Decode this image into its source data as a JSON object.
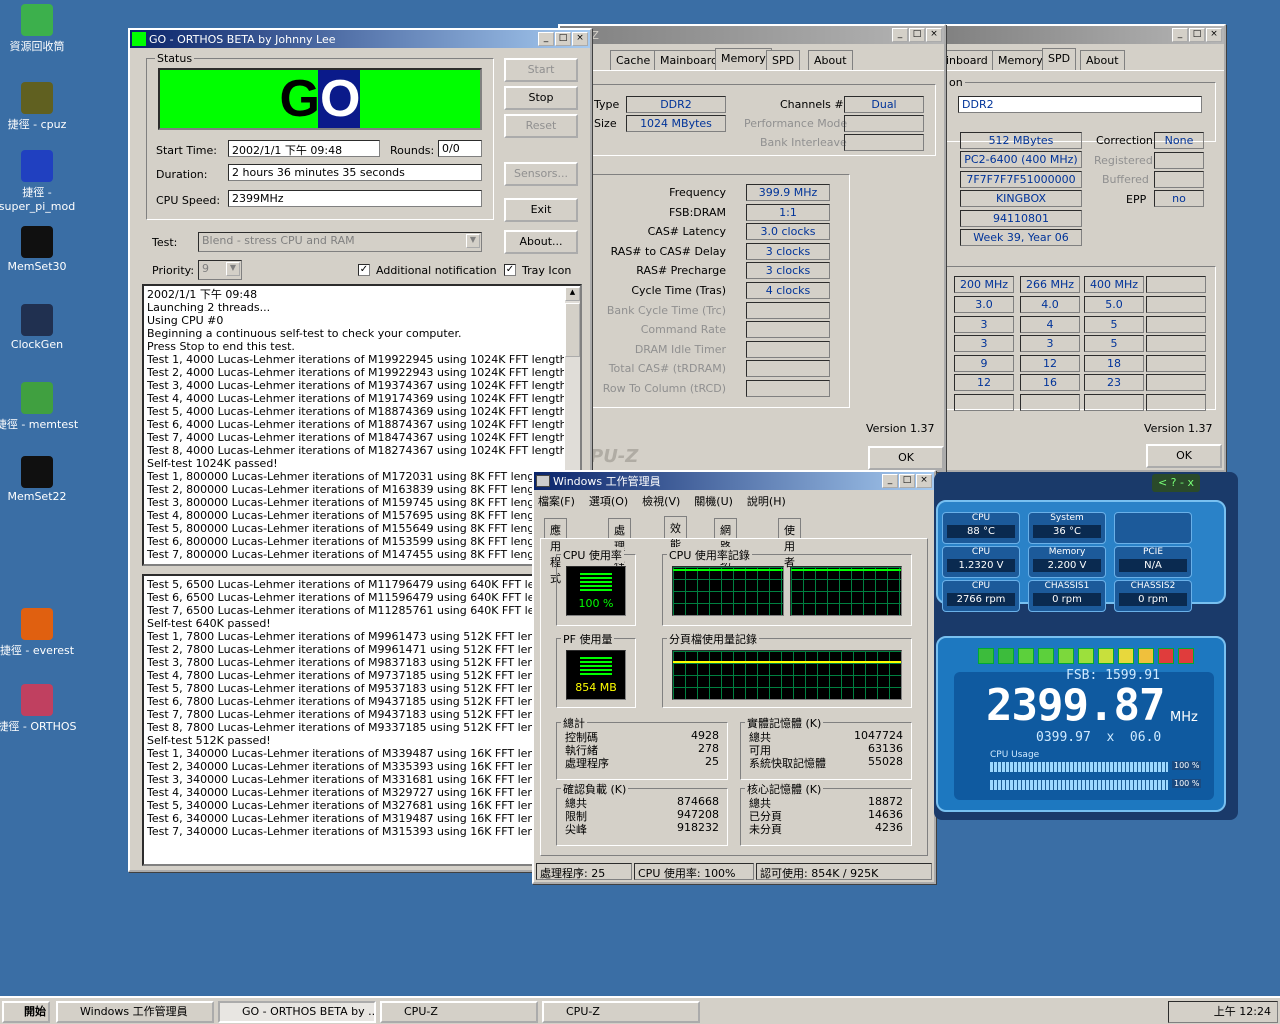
{
  "desktop": {
    "icons": [
      {
        "label": "資源回收筒",
        "color": "#3cb04c"
      },
      {
        "label": "捷徑 - cpuz",
        "color": "#606020"
      },
      {
        "label": "捷徑 - super_pi_mod",
        "color": "#2040c0"
      },
      {
        "label": "MemSet30",
        "color": "#101010"
      },
      {
        "label": "ClockGen",
        "color": "#203050"
      },
      {
        "label": "捷徑 - memtest",
        "color": "#40a040"
      },
      {
        "label": "MemSet22",
        "color": "#101010"
      },
      {
        "label": "捷徑 - everest",
        "color": "#e06010"
      },
      {
        "label": "捷徑 - ORTHOS",
        "color": "#c04060"
      }
    ]
  },
  "orthos": {
    "title": "GO - ORTHOS BETA by Johnny Lee",
    "status_label": "Status",
    "go_text": "GO",
    "start_time_label": "Start Time:",
    "start_time": "2002/1/1 下午 09:48",
    "rounds_label": "Rounds:",
    "rounds": "0/0",
    "duration_label": "Duration:",
    "duration": "2 hours 36 minutes 35 seconds",
    "cpu_speed_label": "CPU Speed:",
    "cpu_speed": "2399MHz",
    "btn_start": "Start",
    "btn_stop": "Stop",
    "btn_reset": "Reset",
    "btn_sensors": "Sensors...",
    "btn_exit": "Exit",
    "btn_about": "About...",
    "test_label": "Test:",
    "test_value": "Blend - stress CPU and RAM",
    "priority_label": "Priority:",
    "priority_value": "9",
    "additional_notification": "Additional notification",
    "tray_icon": "Tray Icon",
    "log1": [
      "2002/1/1 下午 09:48",
      "Launching 2 threads...",
      "Using CPU #0",
      "Beginning a continuous self-test to check your computer.",
      "Press Stop to end this test.",
      "Test 1, 4000 Lucas-Lehmer iterations of M19922945 using 1024K FFT length.",
      "Test 2, 4000 Lucas-Lehmer iterations of M19922943 using 1024K FFT length.",
      "Test 3, 4000 Lucas-Lehmer iterations of M19374367 using 1024K FFT length.",
      "Test 4, 4000 Lucas-Lehmer iterations of M19174369 using 1024K FFT length.",
      "Test 5, 4000 Lucas-Lehmer iterations of M18874369 using 1024K FFT length.",
      "Test 6, 4000 Lucas-Lehmer iterations of M18874367 using 1024K FFT length.",
      "Test 7, 4000 Lucas-Lehmer iterations of M18474367 using 1024K FFT length.",
      "Test 8, 4000 Lucas-Lehmer iterations of M18274367 using 1024K FFT length.",
      "Self-test 1024K passed!",
      "Test 1, 800000 Lucas-Lehmer iterations of M172031 using 8K FFT length.",
      "Test 2, 800000 Lucas-Lehmer iterations of M163839 using 8K FFT length.",
      "Test 3, 800000 Lucas-Lehmer iterations of M159745 using 8K FFT length.",
      "Test 4, 800000 Lucas-Lehmer iterations of M157695 using 8K FFT length.",
      "Test 5, 800000 Lucas-Lehmer iterations of M155649 using 8K FFT length.",
      "Test 6, 800000 Lucas-Lehmer iterations of M153599 using 8K FFT length.",
      "Test 7, 800000 Lucas-Lehmer iterations of M147455 using 8K FFT length."
    ],
    "log2": [
      "Test 5, 6500 Lucas-Lehmer iterations of M11796479 using 640K FFT length.",
      "Test 6, 6500 Lucas-Lehmer iterations of M11596479 using 640K FFT length.",
      "Test 7, 6500 Lucas-Lehmer iterations of M11285761 using 640K FFT length.",
      "Self-test 640K passed!",
      "Test 1, 7800 Lucas-Lehmer iterations of M9961473 using 512K FFT length.",
      "Test 2, 7800 Lucas-Lehmer iterations of M9961471 using 512K FFT length.",
      "Test 3, 7800 Lucas-Lehmer iterations of M9837183 using 512K FFT length.",
      "Test 4, 7800 Lucas-Lehmer iterations of M9737185 using 512K FFT length.",
      "Test 5, 7800 Lucas-Lehmer iterations of M9537183 using 512K FFT length.",
      "Test 6, 7800 Lucas-Lehmer iterations of M9437185 using 512K FFT length.",
      "Test 7, 7800 Lucas-Lehmer iterations of M9437183 using 512K FFT length.",
      "Test 8, 7800 Lucas-Lehmer iterations of M9337185 using 512K FFT length.",
      "Self-test 512K passed!",
      "Test 1, 340000 Lucas-Lehmer iterations of M339487 using 16K FFT length.",
      "Test 2, 340000 Lucas-Lehmer iterations of M335393 using 16K FFT length.",
      "Test 3, 340000 Lucas-Lehmer iterations of M331681 using 16K FFT length.",
      "Test 4, 340000 Lucas-Lehmer iterations of M329727 using 16K FFT length.",
      "Test 5, 340000 Lucas-Lehmer iterations of M327681 using 16K FFT length.",
      "Test 6, 340000 Lucas-Lehmer iterations of M319487 using 16K FFT length.",
      "Test 7, 340000 Lucas-Lehmer iterations of M315393 using 16K FFT length."
    ]
  },
  "cpuz1": {
    "title": "CPU-Z",
    "tabs": [
      "Cache",
      "Mainboard",
      "Memory",
      "SPD",
      "About"
    ],
    "general_label": "neral",
    "type_label": "Type",
    "type": "DDR2",
    "size_label": "Size",
    "size": "1024 MBytes",
    "channels_label": "Channels #",
    "channels": "Dual",
    "perf_mode_label": "Performance Mode",
    "bank_interleave_label": "Bank Interleave",
    "timings_label": "ings",
    "timings": [
      {
        "label": "Frequency",
        "value": "399.9 MHz",
        "enabled": true
      },
      {
        "label": "FSB:DRAM",
        "value": "1:1",
        "enabled": true
      },
      {
        "label": "CAS# Latency",
        "value": "3.0 clocks",
        "enabled": true
      },
      {
        "label": "RAS# to CAS# Delay",
        "value": "3 clocks",
        "enabled": true
      },
      {
        "label": "RAS# Precharge",
        "value": "3 clocks",
        "enabled": true
      },
      {
        "label": "Cycle Time (Tras)",
        "value": "4 clocks",
        "enabled": true
      },
      {
        "label": "Bank Cycle Time (Trc)",
        "value": "",
        "enabled": false
      },
      {
        "label": "Command Rate",
        "value": "",
        "enabled": false
      },
      {
        "label": "DRAM Idle Timer",
        "value": "",
        "enabled": false
      },
      {
        "label": "Total CAS# (tRDRAM)",
        "value": "",
        "enabled": false
      },
      {
        "label": "Row To Column (tRCD)",
        "value": "",
        "enabled": false
      }
    ],
    "version": "Version 1.37",
    "ok": "OK",
    "watermark": "PU-Z"
  },
  "cpuz2": {
    "tabs": [
      "inboard",
      "Memory",
      "SPD",
      "About"
    ],
    "section": "on",
    "type": "DDR2",
    "module_size": "512 MBytes",
    "max_bw": "PC2-6400 (400 MHz)",
    "jedec": "7F7F7F7F51000000",
    "maker": "KINGBOX",
    "serial": "94110801",
    "date": "Week 39, Year 06",
    "correction_label": "Correction",
    "correction": "None",
    "registered_label": "Registered",
    "buffered_label": "Buffered",
    "epp_label": "EPP",
    "epp": "no",
    "freq_headers": [
      "200 MHz",
      "266 MHz",
      "400 MHz"
    ],
    "freq_rows": [
      [
        "3.0",
        "4.0",
        "5.0"
      ],
      [
        "3",
        "4",
        "5"
      ],
      [
        "3",
        "3",
        "5"
      ],
      [
        "9",
        "12",
        "18"
      ],
      [
        "12",
        "16",
        "23"
      ]
    ],
    "version": "Version 1.37",
    "ok": "OK"
  },
  "taskmgr": {
    "title": "Windows 工作管理員",
    "menu": [
      "檔案(F)",
      "選項(O)",
      "檢視(V)",
      "關機(U)",
      "說明(H)"
    ],
    "tabs": [
      "應用程式",
      "處理程序",
      "效能",
      "網路功能",
      "使用者"
    ],
    "cpu_usage_label": "CPU 使用率",
    "cpu_usage": "100 %",
    "cpu_history_label": "CPU 使用率記錄",
    "pf_usage_label": "PF 使用量",
    "pf_usage": "854 MB",
    "pf_history_label": "分頁檔使用量記錄",
    "totals": {
      "label": "總計",
      "rows": [
        {
          "k": "控制碼",
          "v": "4928"
        },
        {
          "k": "執行緒",
          "v": "278"
        },
        {
          "k": "處理程序",
          "v": "25"
        }
      ]
    },
    "physical": {
      "label": "實體記憶體 (K)",
      "rows": [
        {
          "k": "總共",
          "v": "1047724"
        },
        {
          "k": "可用",
          "v": "63136"
        },
        {
          "k": "系統快取記憶體",
          "v": "55028"
        }
      ]
    },
    "commit": {
      "label": "確認負載 (K)",
      "rows": [
        {
          "k": "總共",
          "v": "874668"
        },
        {
          "k": "限制",
          "v": "947208"
        },
        {
          "k": "尖峰",
          "v": "918232"
        }
      ]
    },
    "kernel": {
      "label": "核心記憶體 (K)",
      "rows": [
        {
          "k": "總共",
          "v": "18872"
        },
        {
          "k": "已分頁",
          "v": "14636"
        },
        {
          "k": "未分頁",
          "v": "4236"
        }
      ]
    },
    "status_processes": "處理程序: 25",
    "status_cpu": "CPU 使用率: 100%",
    "status_mem": "認可使用: 854K / 925K"
  },
  "monitor": {
    "cells": [
      {
        "label": "CPU",
        "value": "88 °C"
      },
      {
        "label": "System",
        "value": "36 °C"
      },
      {
        "label": "",
        "value": ""
      },
      {
        "label": "CPU",
        "value": "1.2320 V"
      },
      {
        "label": "Memory",
        "value": "2.200 V"
      },
      {
        "label": "PCIE",
        "value": "N/A"
      },
      {
        "label": "CPU",
        "value": "2766 rpm"
      },
      {
        "label": "CHASSIS1",
        "value": "0 rpm"
      },
      {
        "label": "CHASSIS2",
        "value": "0 rpm"
      }
    ],
    "fsb": "FSB: 1599.91",
    "mhz": "2399.87",
    "mhz_unit": "MHz",
    "multi": "0399.97  x  06.0",
    "cpu_usage_label": "CPU Usage",
    "usage1": "100 %",
    "usage2": "100 %",
    "topbar": "< ? - x"
  },
  "taskbar": {
    "start": "開始",
    "tasks": [
      "Windows 工作管理員",
      "GO - ORTHOS BETA by ...",
      "CPU-Z",
      "CPU-Z"
    ],
    "clock": "上午 12:24"
  }
}
